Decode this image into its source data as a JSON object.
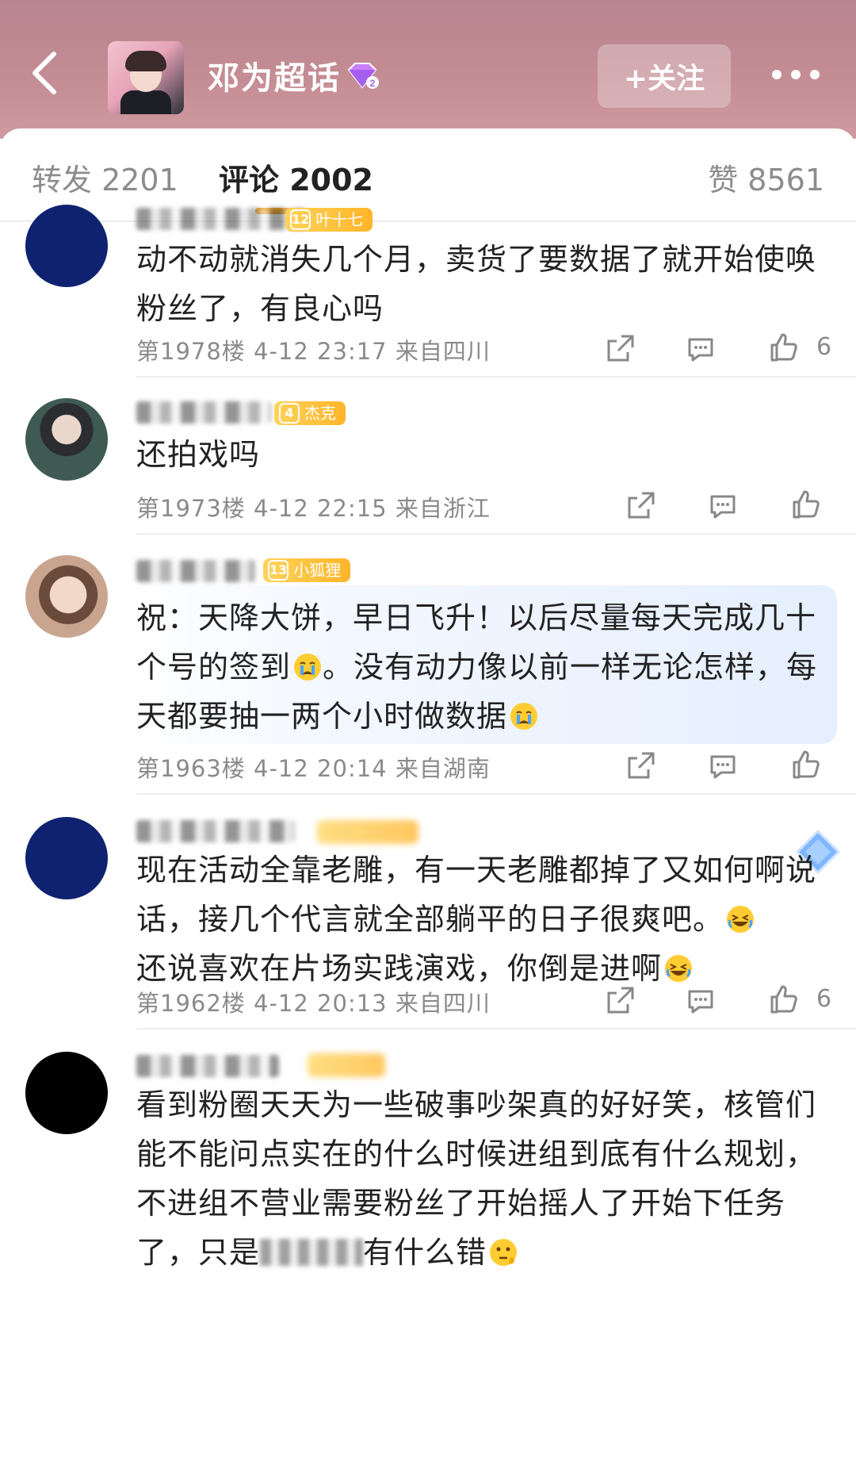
{
  "header": {
    "topic_title": "邓为超话",
    "follow_label": "+关注"
  },
  "tabs": {
    "repost": "转发 2201",
    "comments": "评论 2002",
    "likes": "赞 8561"
  },
  "comments": [
    {
      "badge_level": "12",
      "badge_name": "叶十七",
      "text": "动不动就消失几个月，卖货了要数据了就开始使唤粉丝了，有良心吗",
      "meta": "第1978楼 4-12 23:17 来自四川",
      "likes": "6"
    },
    {
      "badge_level": "4",
      "badge_name": "杰克",
      "text": "还拍戏吗",
      "meta": "第1973楼 4-12 22:15 来自浙江",
      "likes": ""
    },
    {
      "badge_level": "13",
      "badge_name": "小狐狸",
      "text_a": "祝：天降大饼，早日飞升！以后尽量每天完成几十个号的签到",
      "text_b": "。没有动力像以前一样无论怎样，每天都要抽一两个小时做数据",
      "meta": "第1963楼 4-12 20:14 来自湖南",
      "likes": ""
    },
    {
      "text_a": "现在活动全靠老雕，有一天老雕都掉了又如何啊说话，接几个代言就全部躺平的日子很爽吧。",
      "text_b": "还说喜欢在片场实践演戏，你倒是进啊",
      "meta": "第1962楼 4-12 20:13 来自四川",
      "likes": "6"
    },
    {
      "text_a": "看到粉圈天天为一些破事吵架真的好好笑，核管们能不能问点实在的什么时候进组到底有什么规划，不进组不营业需要粉丝了开始摇人了开始下任务了，只是",
      "text_b": "有什么错"
    }
  ],
  "icons": {
    "back": "back-icon",
    "gem": "gem-icon",
    "more": "more-icon",
    "share": "share-icon",
    "comment": "comment-icon",
    "like": "thumbs-up-icon",
    "crying": "crying-emoji-icon",
    "laughing": "laughing-emoji-icon",
    "thinking": "thinking-emoji-icon",
    "diamond": "diamond-decoration-icon"
  },
  "colors": {
    "accent": "#f7a21b",
    "header_bg": "#c48c93",
    "avatar_navy": "#0f2270"
  }
}
